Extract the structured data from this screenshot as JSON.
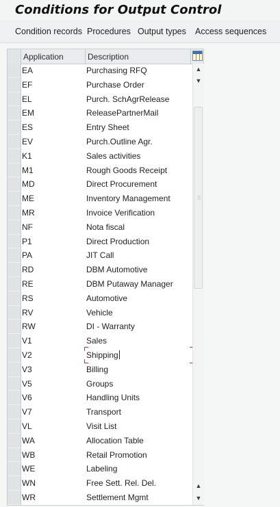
{
  "window": {
    "title": "Conditions for Output Control"
  },
  "menu": {
    "items": [
      {
        "label": "Condition records"
      },
      {
        "label": "Procedures"
      },
      {
        "label": "Output types"
      },
      {
        "label": "Access sequences"
      }
    ]
  },
  "table": {
    "columns": {
      "application": "Application",
      "description": "Description"
    },
    "rows": [
      {
        "app": "EA",
        "desc": "Purchasing RFQ"
      },
      {
        "app": "EF",
        "desc": "Purchase Order"
      },
      {
        "app": "EL",
        "desc": "Purch. SchAgrRelease"
      },
      {
        "app": "EM",
        "desc": "ReleasePartnerMail"
      },
      {
        "app": "ES",
        "desc": "Entry Sheet"
      },
      {
        "app": "EV",
        "desc": "Purch.Outline Agr."
      },
      {
        "app": "K1",
        "desc": "Sales activities"
      },
      {
        "app": "M1",
        "desc": "Rough Goods Receipt"
      },
      {
        "app": "MD",
        "desc": "Direct Procurement"
      },
      {
        "app": "ME",
        "desc": "Inventory Management"
      },
      {
        "app": "MR",
        "desc": "Invoice Verification"
      },
      {
        "app": "NF",
        "desc": "Nota fiscal"
      },
      {
        "app": "P1",
        "desc": "Direct Production"
      },
      {
        "app": "PA",
        "desc": "JIT Call"
      },
      {
        "app": "RD",
        "desc": "DBM Automotive"
      },
      {
        "app": "RE",
        "desc": "DBM Putaway Manager"
      },
      {
        "app": "RS",
        "desc": "Automotive"
      },
      {
        "app": "RV",
        "desc": "Vehicle"
      },
      {
        "app": "RW",
        "desc": "DI - Warranty"
      },
      {
        "app": "V1",
        "desc": "Sales"
      },
      {
        "app": "V2",
        "desc": "Shipping"
      },
      {
        "app": "V3",
        "desc": "Billing"
      },
      {
        "app": "V5",
        "desc": "Groups"
      },
      {
        "app": "V6",
        "desc": "Handling Units"
      },
      {
        "app": "V7",
        "desc": "Transport"
      },
      {
        "app": "VL",
        "desc": "Visit List"
      },
      {
        "app": "WA",
        "desc": "Allocation Table"
      },
      {
        "app": "WB",
        "desc": "Retail Promotion"
      },
      {
        "app": "WE",
        "desc": "Labeling"
      },
      {
        "app": "WN",
        "desc": "Free Sett. Rel. Del."
      },
      {
        "app": "WR",
        "desc": "Settlement Mgmt"
      }
    ]
  },
  "icons": {
    "config": "table-settings-icon",
    "scroll_up": "arrow-up-icon",
    "scroll_down": "arrow-down-icon",
    "page_up": "page-up-icon",
    "page_down": "page-down-icon"
  },
  "colors": {
    "focus": "#c8312d",
    "header_bg": "#e8ecee",
    "selector_bg": "#dfe3e5"
  }
}
